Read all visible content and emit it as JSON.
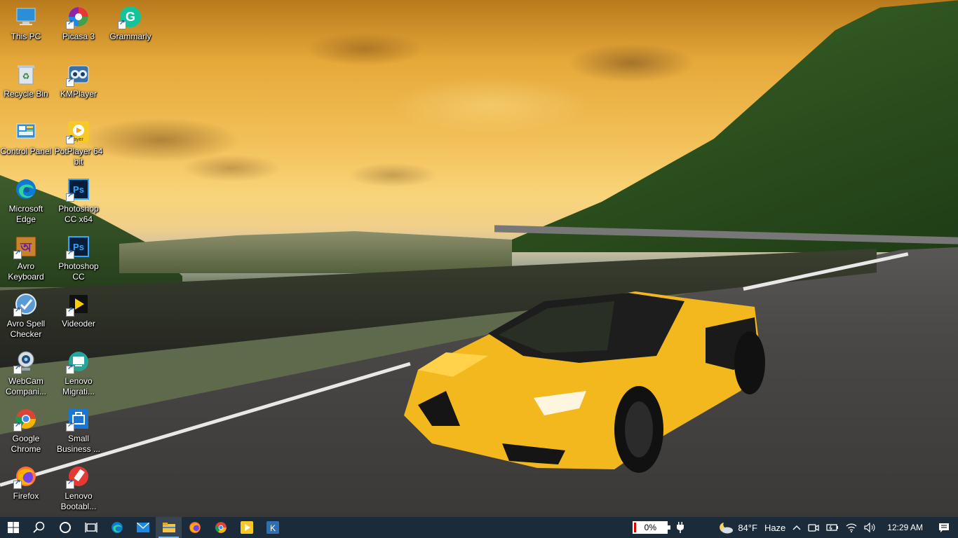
{
  "desktop": {
    "icons": [
      {
        "label": "This PC",
        "icon": "this-pc-icon"
      },
      {
        "label": "Picasa 3",
        "icon": "picasa-icon"
      },
      {
        "label": "Grammarly",
        "icon": "grammarly-icon"
      },
      {
        "label": "Recycle Bin",
        "icon": "recycle-bin-icon"
      },
      {
        "label": "KMPlayer",
        "icon": "kmplayer-icon"
      },
      {
        "label": "Control Panel",
        "icon": "control-panel-icon"
      },
      {
        "label": "PotPlayer 64 bit",
        "icon": "potplayer-icon"
      },
      {
        "label": "Microsoft Edge",
        "icon": "edge-icon"
      },
      {
        "label": "Photoshop CC x64",
        "icon": "photoshop-icon"
      },
      {
        "label": "Avro Keyboard",
        "icon": "avro-keyboard-icon"
      },
      {
        "label": "Photoshop CC",
        "icon": "photoshop-icon"
      },
      {
        "label": "Avro Spell Checker",
        "icon": "avro-spell-checker-icon"
      },
      {
        "label": "Videoder",
        "icon": "videoder-icon"
      },
      {
        "label": "WebCam Compani...",
        "icon": "webcam-icon"
      },
      {
        "label": "Lenovo Migrati...",
        "icon": "lenovo-migration-icon"
      },
      {
        "label": "Google Chrome",
        "icon": "chrome-icon"
      },
      {
        "label": "Small Business ...",
        "icon": "small-business-icon"
      },
      {
        "label": "Firefox",
        "icon": "firefox-icon"
      },
      {
        "label": "Lenovo Bootabl...",
        "icon": "lenovo-bootable-icon"
      }
    ]
  },
  "taskbar": {
    "apps": [
      "start-icon",
      "search-icon",
      "cortana-icon",
      "task-view-icon",
      "edge-icon",
      "mail-icon",
      "file-explorer-icon",
      "firefox-icon",
      "chrome-icon",
      "media-player-icon",
      "kmplayer-icon"
    ],
    "active_app": "file-explorer-icon",
    "battery_percent": "0%",
    "weather_temp": "84°F",
    "weather_condition": "Haze",
    "clock": "12:29 AM"
  },
  "colors": {
    "taskbar_bg": "#1c2b3a",
    "accent": "#76b9ed"
  }
}
